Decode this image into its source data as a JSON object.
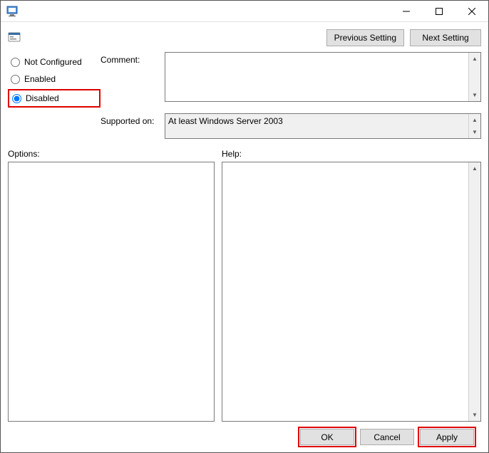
{
  "titlebar": {
    "title": ""
  },
  "nav": {
    "prev_label": "Previous Setting",
    "next_label": "Next Setting"
  },
  "radios": {
    "not_configured": "Not Configured",
    "enabled": "Enabled",
    "disabled": "Disabled",
    "selected": "disabled"
  },
  "fields": {
    "comment_label": "Comment:",
    "comment_value": "",
    "supported_label": "Supported on:",
    "supported_value": "At least Windows Server 2003"
  },
  "sections": {
    "options_label": "Options:",
    "help_label": "Help:",
    "options_content": "",
    "help_content": ""
  },
  "buttons": {
    "ok": "OK",
    "cancel": "Cancel",
    "apply": "Apply"
  }
}
